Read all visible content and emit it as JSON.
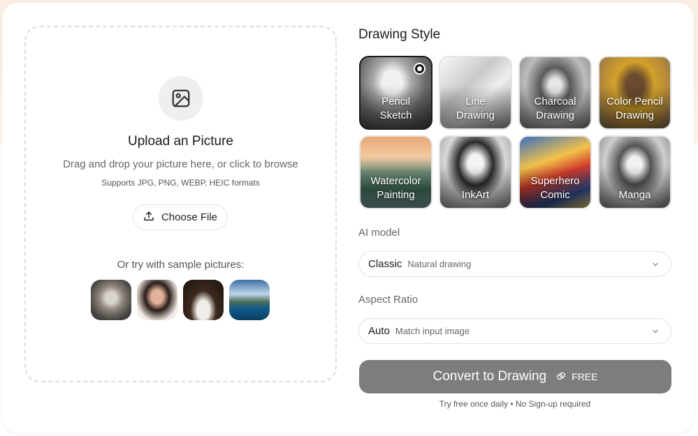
{
  "upload": {
    "title": "Upload an Picture",
    "subtitle": "Drag and drop your picture here, or click to browse",
    "formats": "Supports JPG, PNG, WEBP, HEIC formats",
    "choose_label": "Choose File",
    "sample_label": "Or try with sample pictures:",
    "samples": [
      "cat",
      "woman",
      "man",
      "lake"
    ]
  },
  "drawing_style": {
    "title": "Drawing Style",
    "selected": "Pencil Sketch",
    "styles": [
      {
        "label": "Pencil\nSketch"
      },
      {
        "label": "Line\nDrawing"
      },
      {
        "label": "Charcoal\nDrawing"
      },
      {
        "label": "Color Pencil\nDrawing"
      },
      {
        "label": "Watercolor\nPainting"
      },
      {
        "label": "InkArt"
      },
      {
        "label": "Superhero\nComic"
      },
      {
        "label": "Manga"
      }
    ]
  },
  "ai_model": {
    "label": "AI model",
    "value": "Classic",
    "hint": "Natural drawing"
  },
  "aspect_ratio": {
    "label": "Aspect Ratio",
    "value": "Auto",
    "hint": "Match input image"
  },
  "convert": {
    "label": "Convert to Drawing",
    "badge": "FREE",
    "note": "Try free once daily • No Sign-up required"
  },
  "colors": {
    "button_bg": "#7d7d7d",
    "selected_border": "#1a1a1a"
  }
}
